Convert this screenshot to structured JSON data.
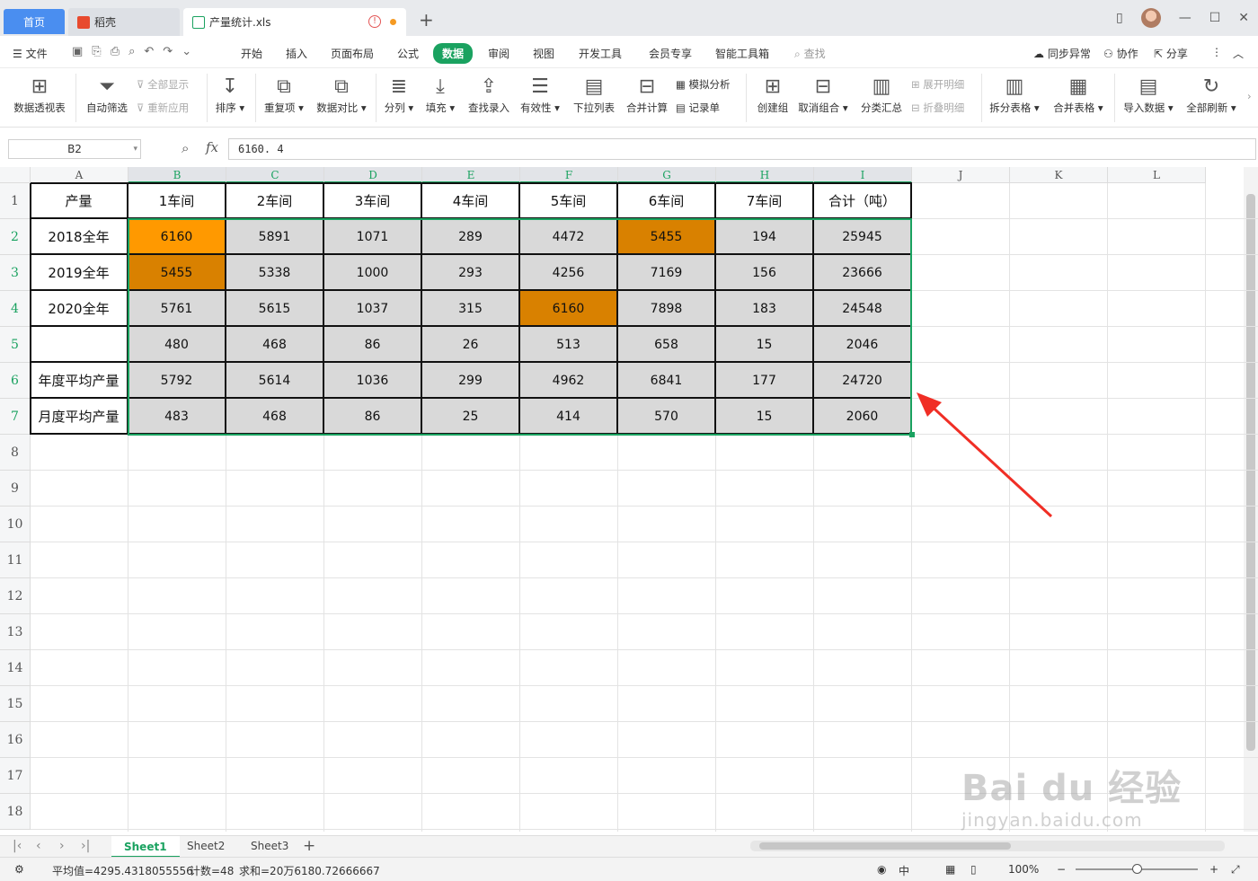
{
  "tabs": {
    "home": "首页",
    "daoke": "稻壳",
    "file": "产量统计.xls",
    "warn_glyph": "!"
  },
  "menu": {
    "file": "文件",
    "items": [
      "开始",
      "插入",
      "页面布局",
      "公式",
      "数据",
      "审阅",
      "视图",
      "开发工具",
      "会员专享",
      "智能工具箱"
    ],
    "active": "数据",
    "search": "查找",
    "sync": "同步异常",
    "collab": "协作",
    "share": "分享"
  },
  "ribbon": {
    "pivot": "数据透视表",
    "autofilter": "自动筛选",
    "show_all": "全部显示",
    "reapply": "重新应用",
    "sort": "排序",
    "duplicates": "重复项",
    "compare": "数据对比",
    "split_col": "分列",
    "fill": "填充",
    "lookup": "查找录入",
    "validity": "有效性",
    "dropdown": "下拉列表",
    "consolidate": "合并计算",
    "whatif": "模拟分析",
    "record": "记录单",
    "group": "创建组",
    "ungroup": "取消组合",
    "subtotal": "分类汇总",
    "expand": "展开明细",
    "collapse": "折叠明细",
    "split_table": "拆分表格",
    "merge_table": "合并表格",
    "import": "导入数据",
    "refresh": "全部刷新"
  },
  "formula_bar": {
    "name_box": "B2",
    "fx": "fx",
    "value": "6160. 4"
  },
  "columns": [
    "A",
    "B",
    "C",
    "D",
    "E",
    "F",
    "G",
    "H",
    "I",
    "J",
    "K",
    "L"
  ],
  "rows": [
    "1",
    "2",
    "3",
    "4",
    "5",
    "6",
    "7",
    "8",
    "9",
    "10",
    "11",
    "12",
    "13",
    "14",
    "15",
    "16",
    "17",
    "18"
  ],
  "table": {
    "header": [
      "产量",
      "1车间",
      "2车间",
      "3车间",
      "4车间",
      "5车间",
      "6车间",
      "7车间",
      "合计（吨）"
    ],
    "rows": [
      {
        "label": "2018全年",
        "values": [
          "6160",
          "5891",
          "1071",
          "289",
          "4472",
          "5455",
          "194",
          "25945"
        ]
      },
      {
        "label": "2019全年",
        "values": [
          "5455",
          "5338",
          "1000",
          "293",
          "4256",
          "7169",
          "156",
          "23666"
        ]
      },
      {
        "label": "2020全年",
        "values": [
          "5761",
          "5615",
          "1037",
          "315",
          "6160",
          "7898",
          "183",
          "24548"
        ]
      },
      {
        "label": "",
        "values": [
          "480",
          "468",
          "86",
          "26",
          "513",
          "658",
          "15",
          "2046"
        ]
      },
      {
        "label": "年度平均产量",
        "values": [
          "5792",
          "5614",
          "1036",
          "299",
          "4962",
          "6841",
          "177",
          "24720"
        ]
      },
      {
        "label": "月度平均产量",
        "values": [
          "483",
          "468",
          "86",
          "25",
          "414",
          "570",
          "15",
          "2060"
        ]
      }
    ]
  },
  "highlight_colors": {
    "bright_orange": "#ff9900",
    "dark_orange": "#d98100",
    "selection": "#1aa260"
  },
  "sheets": [
    "Sheet1",
    "Sheet2",
    "Sheet3"
  ],
  "status": {
    "average": "平均值=4295.4318055556",
    "count": "计数=48",
    "sum": "求和=20万6180.72666667",
    "zoom": "100%",
    "lang": "中"
  },
  "watermark": {
    "main": "Bai du 经验",
    "sub": "jingyan.baidu.com"
  }
}
